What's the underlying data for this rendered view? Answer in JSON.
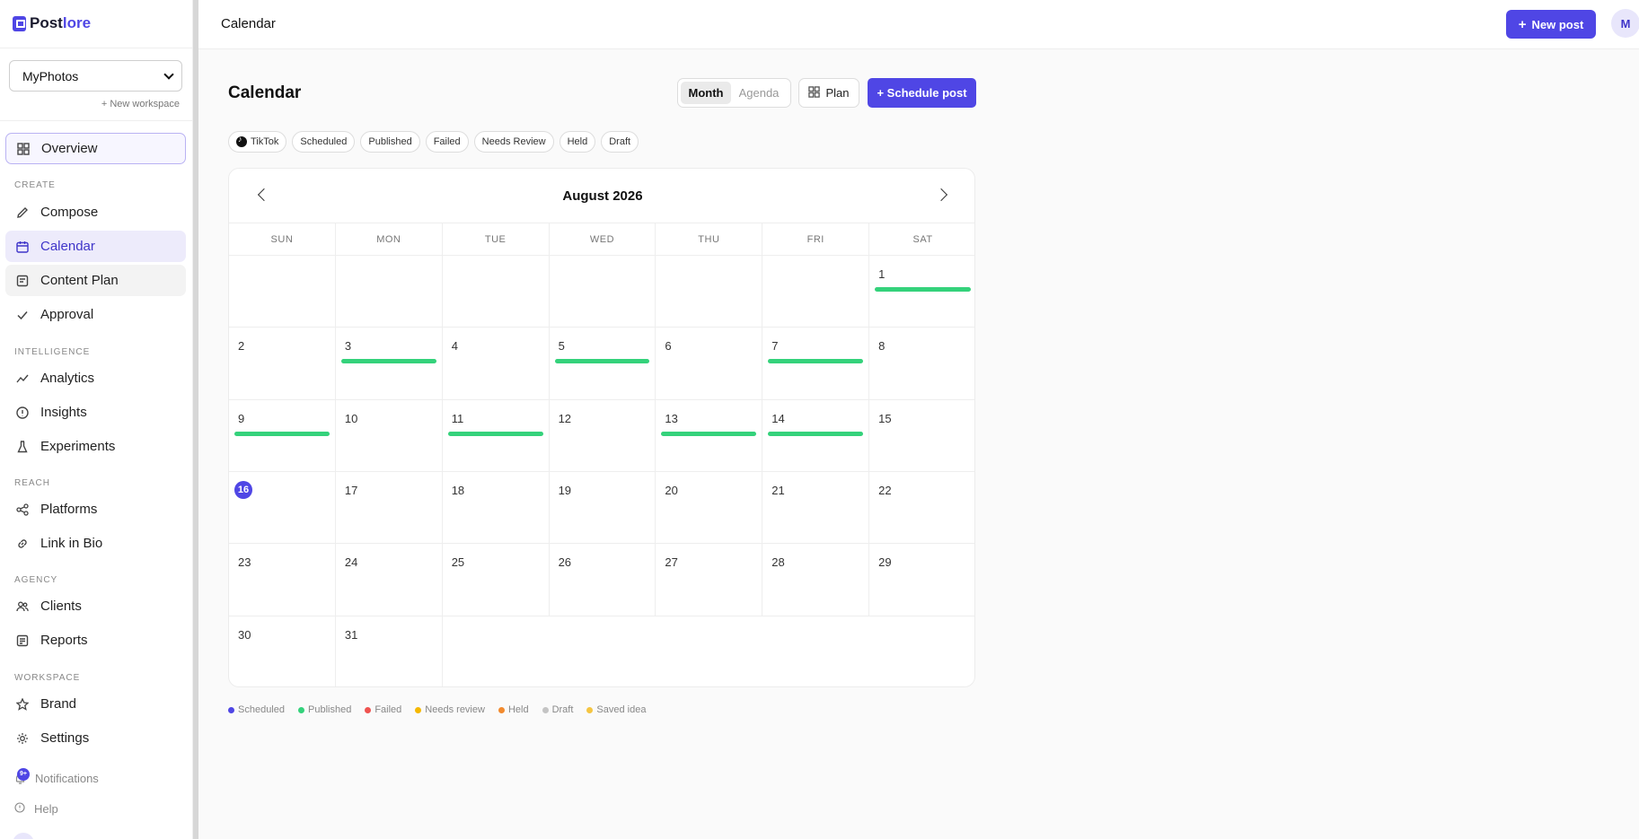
{
  "app": {
    "logo_left": "Post",
    "logo_right": "lore"
  },
  "sidebar": {
    "workspace": "MyPhotos",
    "new_workspace": "+ New workspace",
    "overview": "Overview",
    "sections": {
      "create": "CREATE",
      "intelligence": "INTELLIGENCE",
      "reach": "REACH",
      "agency": "AGENCY",
      "workspace": "WORKSPACE"
    },
    "items": {
      "compose": "Compose",
      "calendar": "Calendar",
      "content_plan": "Content Plan",
      "approval": "Approval",
      "analytics": "Analytics",
      "insights": "Insights",
      "experiments": "Experiments",
      "platforms": "Platforms",
      "link_in_bio": "Link in Bio",
      "clients": "Clients",
      "reports": "Reports",
      "brand": "Brand",
      "settings": "Settings"
    },
    "notifications": "Notifications",
    "notifications_badge": "9+",
    "help": "Help"
  },
  "topbar": {
    "title": "Calendar",
    "new_post": "New post",
    "avatar": "M"
  },
  "main": {
    "title": "Calendar",
    "view_month": "Month",
    "view_agenda": "Agenda",
    "plan": "Plan",
    "schedule_post": "+ Schedule post",
    "filters": [
      "TikTok",
      "Scheduled",
      "Published",
      "Failed",
      "Needs Review",
      "Held",
      "Draft"
    ]
  },
  "calendar": {
    "month_label": "August 2026",
    "weekdays": [
      "SUN",
      "MON",
      "TUE",
      "WED",
      "THU",
      "FRI",
      "SAT"
    ],
    "first_weekday_index": 6,
    "days_in_month": 31,
    "today": 16,
    "published_days": [
      1,
      3,
      5,
      7,
      9,
      11,
      13,
      14
    ]
  },
  "legend": [
    {
      "label": "Scheduled",
      "color": "#4f46e5"
    },
    {
      "label": "Published",
      "color": "#34d27b"
    },
    {
      "label": "Failed",
      "color": "#ef5350"
    },
    {
      "label": "Needs review",
      "color": "#f5b800"
    },
    {
      "label": "Held",
      "color": "#f28a2e"
    },
    {
      "label": "Draft",
      "color": "#c4c4c4"
    },
    {
      "label": "Saved idea",
      "color": "#f5c542"
    }
  ]
}
